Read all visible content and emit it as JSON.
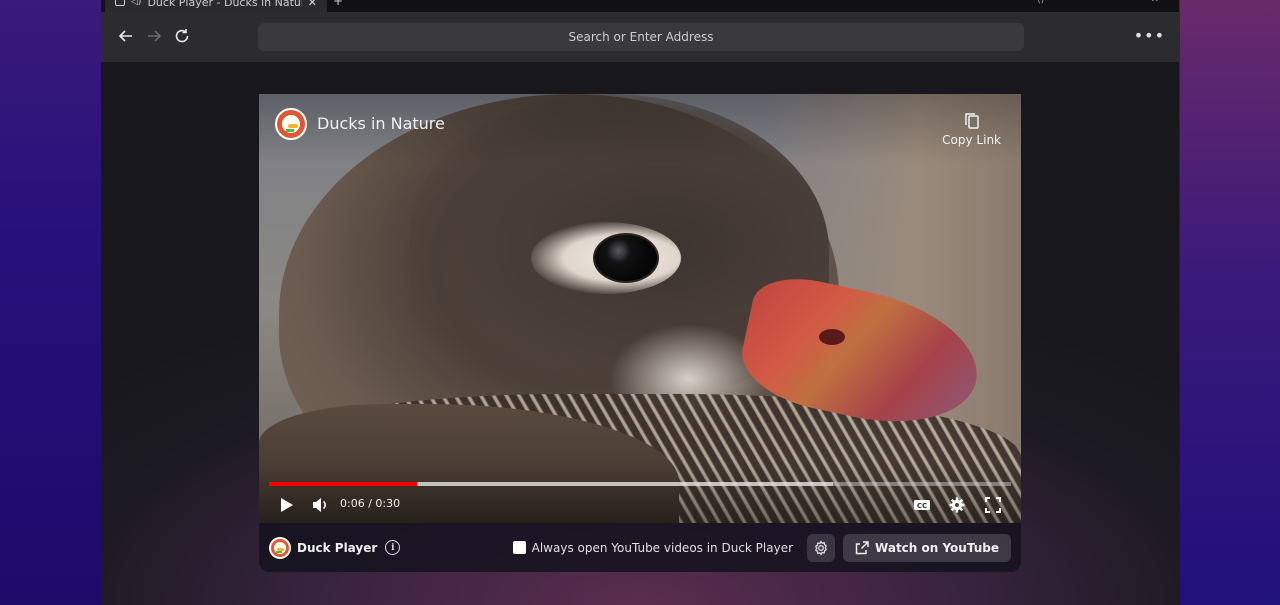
{
  "browser": {
    "tab_title": "Duck Player - Ducks in Nature",
    "address_placeholder": "Search or Enter Address",
    "icons": {
      "back": "arrow-left-icon",
      "forward": "arrow-right-icon",
      "reload": "reload-icon",
      "menu": "more-horizontal-icon"
    },
    "menu_label": "•••"
  },
  "video": {
    "title": "Ducks in Nature",
    "copy_link_label": "Copy Link",
    "current_time": "0:06",
    "duration": "0:30",
    "time_display": "0:06 / 0:30",
    "progress_fraction": 0.2,
    "buffer_fraction": 0.76,
    "progress_color": "#ff0000"
  },
  "footer": {
    "brand": "Duck Player",
    "always_open_label": "Always open YouTube videos in Duck Player",
    "always_open_checked": false,
    "watch_on_youtube_label": "Watch on YouTube"
  },
  "colors": {
    "brand_orange": "#de5833",
    "toolbar_bg": "#2c2c2f",
    "address_bg": "#3a3a3d"
  }
}
